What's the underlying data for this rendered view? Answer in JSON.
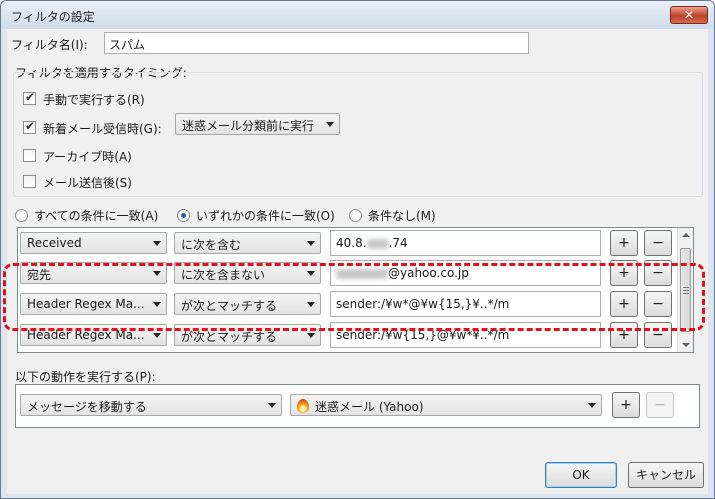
{
  "window": {
    "title": "フィルタの設定",
    "close_glyph": "✕"
  },
  "filter_name": {
    "label": "フィルタ名(I):",
    "value": "スパム"
  },
  "timing": {
    "group_label": "フィルタを適用するタイミング:",
    "manual": {
      "label": "手動で実行する(R)",
      "checked": true
    },
    "on_receive": {
      "label": "新着メール受信時(G):",
      "checked": true,
      "select_value": "迷惑メール分類前に実行"
    },
    "archive": {
      "label": "アーカイブ時(A)",
      "checked": false
    },
    "after_send": {
      "label": "メール送信後(S)",
      "checked": false
    }
  },
  "match_mode": {
    "all": "すべての条件に一致(A)",
    "any": "いずれかの条件に一致(O)",
    "none": "条件なし(M)",
    "selected": "any"
  },
  "conditions": [
    {
      "field": "Received",
      "operator": "に次を含む",
      "value_prefix": "40.8.",
      "value_suffix": ".74",
      "redacted": true
    },
    {
      "field": "宛先",
      "operator": "に次を含まない",
      "value_prefix": "",
      "value_suffix": "@yahoo.co.jp",
      "redacted": true
    },
    {
      "field": "Header Regex Ma...",
      "operator": "が次とマッチする",
      "value_prefix": "sender:/¥w*@¥w{15,}¥..*/m",
      "value_suffix": "",
      "redacted": false
    },
    {
      "field": "Header Regex Ma...",
      "operator": "が次とマッチする",
      "value_prefix": "sender:/¥w{15,}@¥w*¥..*/m",
      "value_suffix": "",
      "redacted": false
    }
  ],
  "buttons": {
    "add": "+",
    "remove": "−",
    "ok": "OK",
    "cancel": "キャンセル"
  },
  "actions": {
    "label": "以下の動作を実行する(P):",
    "action": "メッセージを移動する",
    "target": "迷惑メール (Yahoo)"
  },
  "colors": {
    "highlight": "#e0101c",
    "accent": "#2a5ca8"
  }
}
